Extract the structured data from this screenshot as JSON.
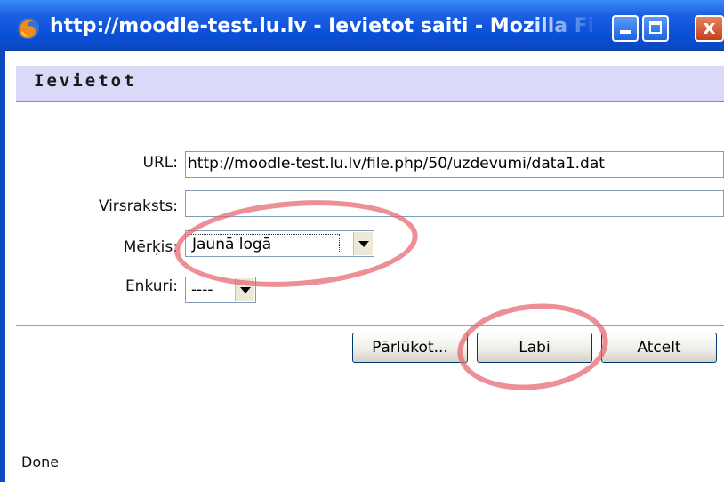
{
  "window": {
    "title": "http://moodle-test.lu.lv - Ievietot saiti - Mozilla Firefox",
    "minimize_icon": "minimize-icon",
    "maximize_icon": "maximize-icon",
    "close_icon": "close-icon",
    "close_glyph": "x"
  },
  "dialog": {
    "header": "Ievietot",
    "fields": {
      "url_label": "URL:",
      "url_value": "http://moodle-test.lu.lv/file.php/50/uzdevumi/data1.dat",
      "title_label": "Virsraksts:",
      "title_value": "",
      "target_label": "Mērķis:",
      "target_value": "Jaunā logā",
      "anchor_label": "Enkuri:",
      "anchor_value": "----"
    },
    "buttons": {
      "browse": "Pārlūkot...",
      "ok": "Labi",
      "cancel": "Atcelt"
    }
  },
  "status_bar": {
    "text": "Done"
  },
  "colors": {
    "titlebar": "#0a4fd8",
    "header_band": "#dadaf8",
    "annotation": "#e6646e"
  }
}
